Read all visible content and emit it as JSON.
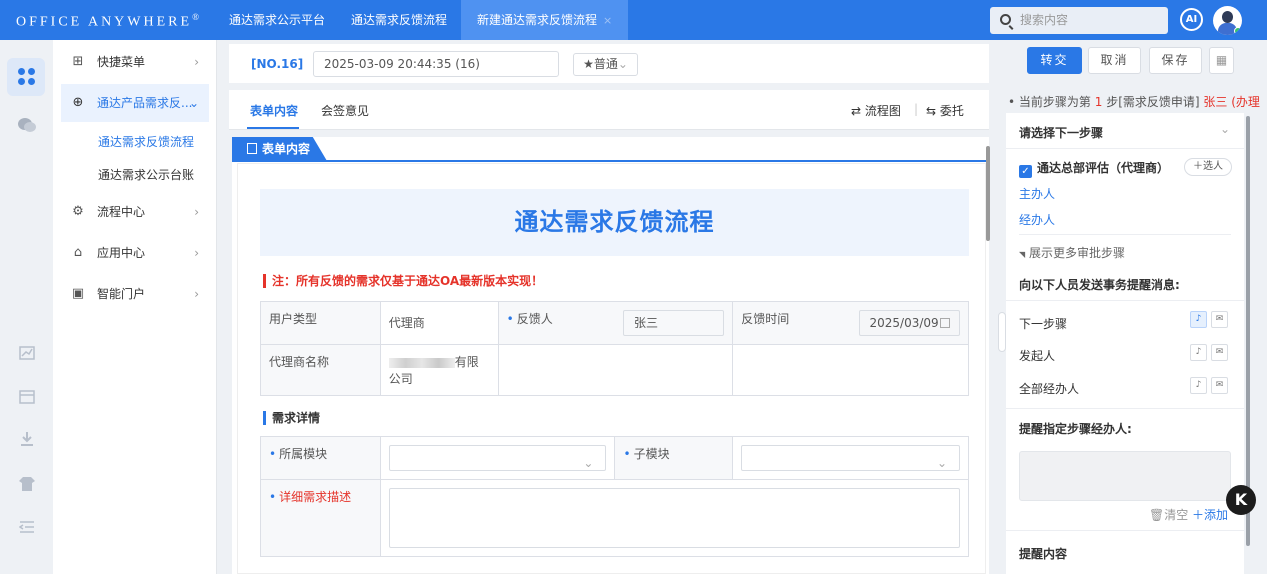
{
  "topbar": {
    "logo": "OFFICE ANYWHERE",
    "logo_mark": "®",
    "tabs": [
      "通达需求公示平台",
      "通达需求反馈流程",
      "新建通达需求反馈流程"
    ],
    "tab_close": "×",
    "search_placeholder": "搜索内容",
    "ai_label": "AI"
  },
  "nav": {
    "items": [
      {
        "label": "快捷菜单",
        "icon": "grid-icon"
      },
      {
        "label": "通达产品需求反...",
        "icon": "globe-icon"
      },
      {
        "label": "流程中心",
        "icon": "flow-icon"
      },
      {
        "label": "应用中心",
        "icon": "bag-icon"
      },
      {
        "label": "智能门户",
        "icon": "portal-icon"
      }
    ],
    "sub_items": [
      "通达需求反馈流程",
      "通达需求公示台账"
    ]
  },
  "form_header": {
    "number": "[NO.16]",
    "datetime": "2025-03-09 20:44:35 (16)",
    "priority": "★普通"
  },
  "tabs": {
    "form": "表单内容",
    "opinion": "会签意见",
    "flowchart": "流程图",
    "delegate": "委托"
  },
  "form": {
    "ribbon": "表单内容",
    "title": "通达需求反馈流程",
    "note": "注：所有反馈的需求仅基于通达OA最新版本实现！",
    "user_type_label": "用户类型",
    "user_type_value": "代理商",
    "feedback_person_label": "反馈人",
    "feedback_person_value": "张三",
    "feedback_time_label": "反馈时间",
    "feedback_time_value": "2025/03/09",
    "agent_name_label": "代理商名称",
    "agent_name_suffix": "有限",
    "agent_name_line2": "公司",
    "section_detail": "需求详情",
    "module_label": "所属模块",
    "submodule_label": "子模块",
    "detail_desc_label": "详细需求描述"
  },
  "actions": {
    "transfer": "转交",
    "cancel": "取消",
    "save": "保存"
  },
  "right_panel": {
    "step_info_prefix": "当前步骤为第",
    "step_number": "1",
    "step_info_suffix": "步[需求反馈申请]",
    "step_user": "张三 (办理...",
    "select_next": "请选择下一步骤",
    "next_step_name": "通达总部评估（代理商）",
    "add_person": "选人",
    "host": "主办人",
    "handler": "经办人",
    "more_steps": "展示更多审批步骤",
    "notify_title": "向以下人员发送事务提醒消息:",
    "notify_rows": [
      "下一步骤",
      "发起人",
      "全部经办人"
    ],
    "remind_title": "提醒指定步骤经办人:",
    "clear": "清空",
    "add": "添加",
    "remind_content": "提醒内容"
  }
}
